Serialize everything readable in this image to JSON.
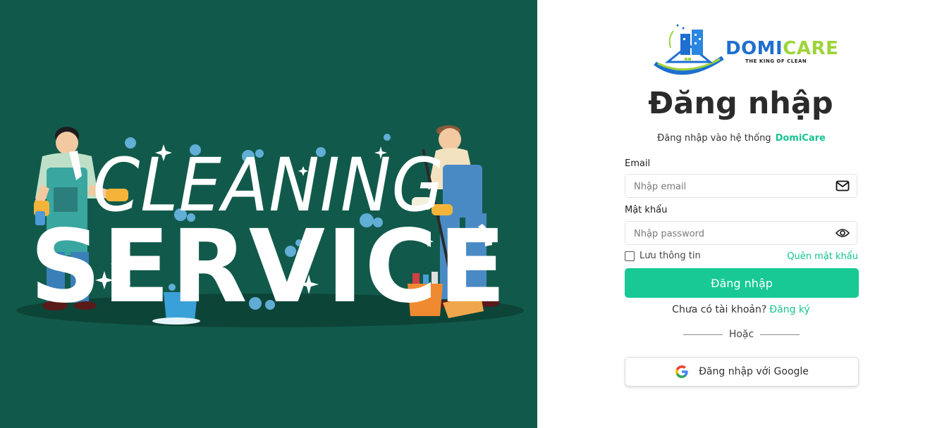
{
  "hero": {
    "line1": "CLEANING",
    "line2": "SERVICE",
    "bg_color": "#115a4b"
  },
  "brand": {
    "name_part1": "DOMI",
    "name_part2": "CARE",
    "tagline": "THE KING OF CLEAN",
    "color_primary": "#1e6fd0",
    "color_secondary": "#9ed43b"
  },
  "form": {
    "title": "Đăng nhập",
    "subtitle": "Đăng nhập vào hệ thống",
    "subtitle_highlight": "DomiCare",
    "email_label": "Email",
    "email_placeholder": "Nhập email",
    "email_icon": "envelope-icon",
    "password_label": "Mật khẩu",
    "password_placeholder": "Nhập password",
    "password_icon": "eye-icon",
    "remember_label": "Lưu thông tin",
    "remember_checked": false,
    "forgot_link": "Quên mật khẩu",
    "login_button": "Đăng nhập",
    "no_account_text": "Chưa có tài khoản?",
    "signup_link": "Đăng ký",
    "or_text": "Hoặc",
    "google_button": "Đăng nhập với Google",
    "accent_color": "#18c995"
  }
}
